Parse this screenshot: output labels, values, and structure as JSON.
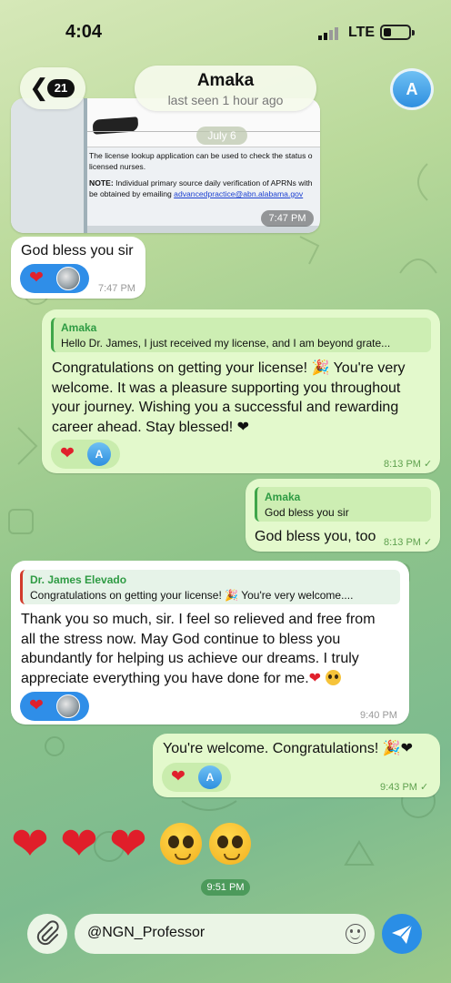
{
  "status_bar": {
    "time": "4:04",
    "network": "LTE"
  },
  "header": {
    "back_count": "21",
    "chat_name": "Amaka",
    "last_seen": "last seen 1 hour ago",
    "avatar_letter": "A"
  },
  "date_chip": "July 6",
  "image_message": {
    "lines": [
      "The license lookup application can be used to check the status o",
      "licensed nurses."
    ],
    "note_label": "NOTE:",
    "note_text": " Individual primary source daily verification of APRNs with",
    "note_text2": "be obtained by emailing ",
    "note_link": "advancedpractice@abn.alabama.gov",
    "time": "7:47 PM"
  },
  "messages": [
    {
      "id": "m1",
      "direction": "in",
      "text": "God bless you sir",
      "time": "7:47 PM",
      "reactions": [
        "heart-icon",
        "photo-avatar"
      ]
    },
    {
      "id": "m2",
      "direction": "out",
      "reply_name": "Amaka",
      "reply_text": "Hello Dr. James, I just received my license, and I am beyond grate...",
      "text_lines": [
        "Congratulations on getting your license! 🎉 You're very",
        "welcome. It was a pleasure supporting you throughout",
        "your journey. Wishing you a successful and rewarding",
        "career ahead. Stay blessed! ❤"
      ],
      "time": "8:13 PM",
      "status": "read",
      "reactions": [
        "heart-icon",
        "avatar-A"
      ]
    },
    {
      "id": "m3",
      "direction": "out",
      "reply_name": "Amaka",
      "reply_text": "God bless you sir",
      "text": "God bless you, too",
      "time": "8:13 PM",
      "status": "read"
    },
    {
      "id": "m4",
      "direction": "in",
      "reply_name": "Dr. James Elevado",
      "reply_text": "Congratulations on getting your license! 🎉 You're very welcome....",
      "text_lines": [
        "Thank you so much, sir. I feel so relieved and free from",
        "all the stress now. May God continue to bless you",
        "abundantly for helping us achieve our dreams. I truly",
        "appreciate everything you have done for me."
      ],
      "time": "9:40 PM",
      "reactions": [
        "heart-icon",
        "photo-avatar"
      ]
    },
    {
      "id": "m5",
      "direction": "out",
      "text": "You're welcome. Congratulations! 🎉❤",
      "time": "9:43 PM",
      "status": "read",
      "reactions": [
        "heart-icon",
        "avatar-A"
      ]
    }
  ],
  "emoji_message": {
    "items": [
      "heart",
      "heart",
      "heart",
      "pleading-face",
      "pleading-face"
    ],
    "time": "9:51 PM"
  },
  "composer": {
    "text": "@NGN_Professor"
  },
  "colors": {
    "accent": "#2a8ee6",
    "outgoing_bubble": "#e3f9cc",
    "incoming_bubble": "#ffffff",
    "heart": "#e0202c"
  }
}
